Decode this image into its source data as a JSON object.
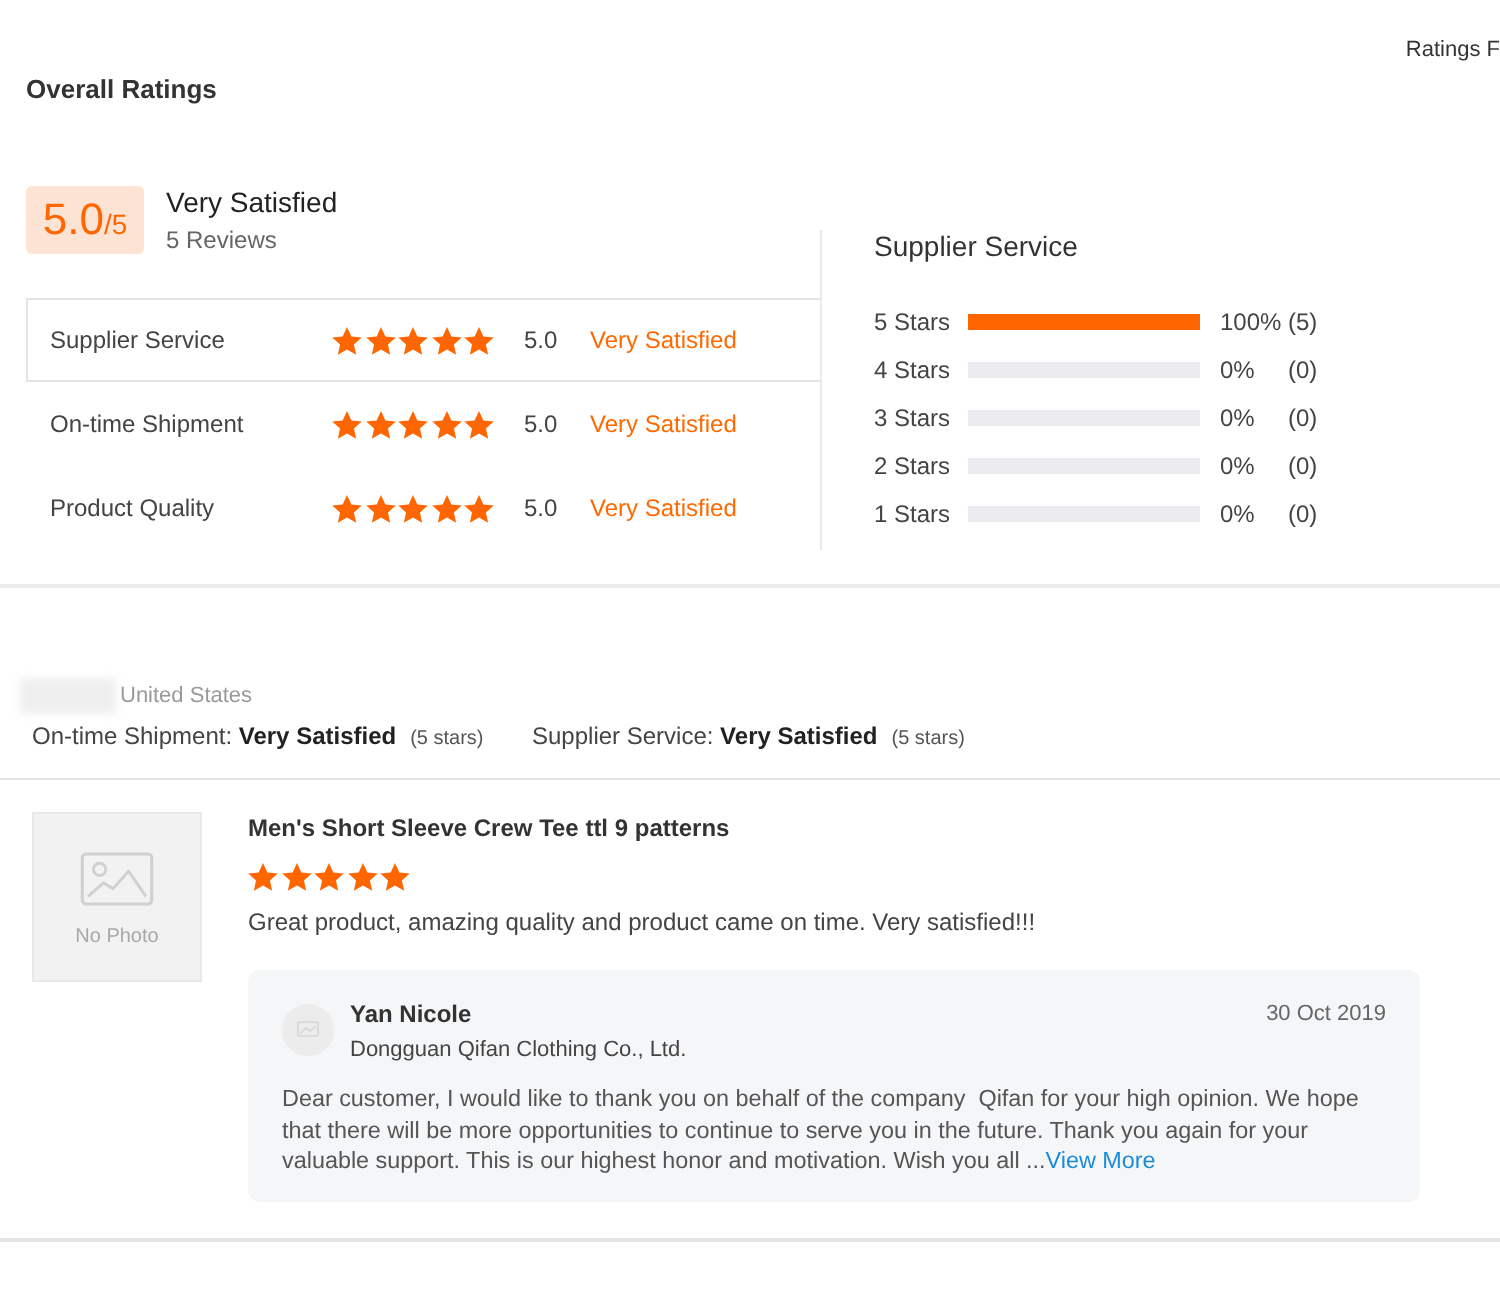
{
  "header_text": "Ratings F",
  "overall": {
    "title": "Overall Ratings",
    "score": "5.0",
    "out_of": "/5",
    "verdict": "Very Satisfied",
    "review_count": "5 Reviews"
  },
  "categories": [
    {
      "label": "Supplier Service",
      "stars": 5,
      "score": "5.0",
      "verdict": "Very Satisfied",
      "selected": true
    },
    {
      "label": "On-time Shipment",
      "stars": 5,
      "score": "5.0",
      "verdict": "Very Satisfied",
      "selected": false
    },
    {
      "label": "Product Quality",
      "stars": 5,
      "score": "5.0",
      "verdict": "Very Satisfied",
      "selected": false
    }
  ],
  "breakdown": {
    "title": "Supplier Service",
    "rows": [
      {
        "label": "5 Stars",
        "level": 1,
        "percent": "100%",
        "count": "(5)"
      },
      {
        "label": "4 Stars",
        "level": 0,
        "percent": "0%",
        "count": "(0)"
      },
      {
        "label": "3 Stars",
        "level": 0,
        "percent": "0%",
        "count": "(0)"
      },
      {
        "label": "2 Stars",
        "level": 0,
        "percent": "0%",
        "count": "(0)"
      },
      {
        "label": "1 Stars",
        "level": 0,
        "percent": "0%",
        "count": "(0)"
      }
    ]
  },
  "reviews": [
    {
      "name_blurred": true,
      "location": "United States",
      "ratings": [
        {
          "text": "On-time Shipment: **Very Satisfied**",
          "note": "(5 stars)"
        },
        {
          "text": "Supplier Service: **Very Satisfied**",
          "note": "(5 stars)"
        }
      ],
      "product": {
        "photo_label": "No Photo",
        "title": "Men's Short Sleeve Crew Tee ttl 9 patterns",
        "stars": 5,
        "comment": "Great product, amazing quality and product came on time. Very satisfied!!!"
      },
      "reply": {
        "name": "Yan Nicole",
        "company": "Dongguan Qifan Clothing Co., Ltd.",
        "date": "30 Oct 2019",
        "text": "Dear customer, I would like to thank you on behalf of the company  Qifan for your high opinion. We hope that there will be more opportunities to continue to serve you in the future. Thank you again for your valuable support. This is our highest honor and motivation. Wish you all ...",
        "link": "View More"
      }
    }
  ]
}
